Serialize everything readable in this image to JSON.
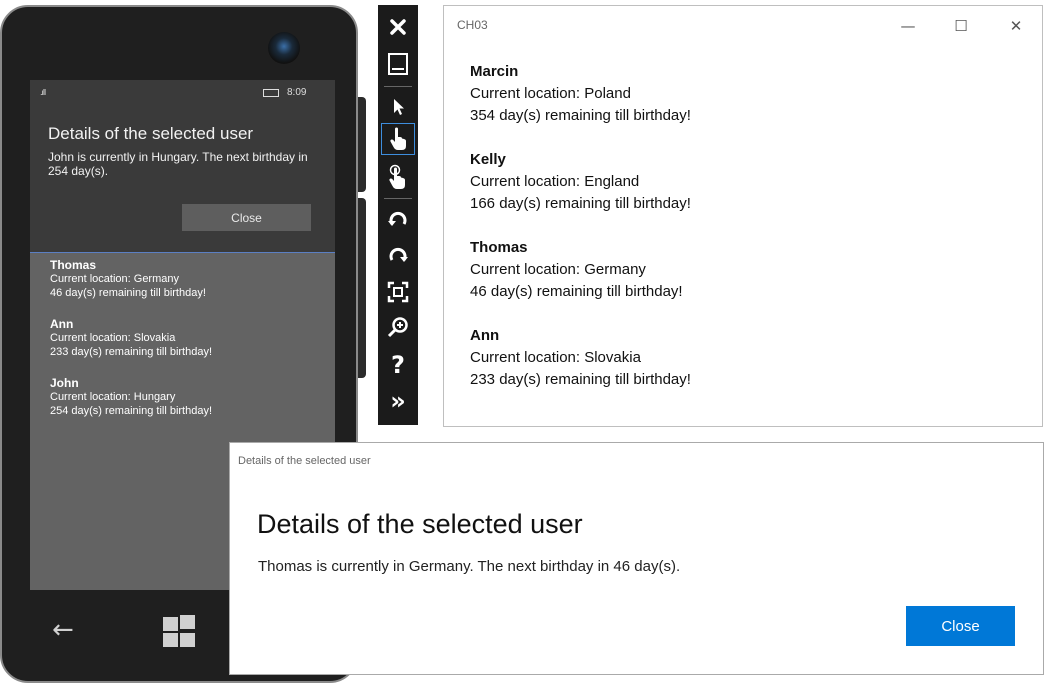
{
  "phone": {
    "status": {
      "time": "8:09",
      "signal": ".ıll"
    },
    "dialog": {
      "title": "Details of the selected user",
      "message": "John is currently in Hungary. The next birthday in 254 day(s).",
      "close_label": "Close"
    },
    "people": [
      {
        "name": "Thomas",
        "location": "Current location:  Germany",
        "birthday": "46 day(s) remaining till birthday!"
      },
      {
        "name": "Ann",
        "location": "Current location:  Slovakia",
        "birthday": "233 day(s) remaining till birthday!"
      },
      {
        "name": "John",
        "location": "Current location:  Hungary",
        "birthday": "254 day(s) remaining till birthday!"
      }
    ],
    "nav": {
      "back_icon": "←"
    }
  },
  "toolbar": {
    "items": [
      {
        "icon": "close-icon",
        "glyph": "✕"
      },
      {
        "icon": "minimize-icon",
        "glyph": "▁"
      },
      {
        "icon": "pointer-icon",
        "glyph": "➤"
      },
      {
        "icon": "single-touch-icon",
        "glyph": "☝"
      },
      {
        "icon": "pinch-zoom-icon",
        "glyph": "☝"
      },
      {
        "icon": "rotate-left-icon",
        "glyph": "↺"
      },
      {
        "icon": "rotate-right-icon",
        "glyph": "↻"
      },
      {
        "icon": "fit-screen-icon",
        "glyph": "⛶"
      },
      {
        "icon": "zoom-icon",
        "glyph": "⊕"
      },
      {
        "icon": "help-icon",
        "glyph": "?"
      },
      {
        "icon": "more-icon",
        "glyph": "»"
      }
    ]
  },
  "window": {
    "title": "CH03",
    "minimize": "—",
    "maximize": "☐",
    "close": "✕",
    "people": [
      {
        "name": "Marcin",
        "location": "Current location:  Poland",
        "birthday": "354 day(s) remaining till birthday!"
      },
      {
        "name": "Kelly",
        "location": "Current location:  England",
        "birthday": "166 day(s) remaining till birthday!"
      },
      {
        "name": "Thomas",
        "location": "Current location:  Germany",
        "birthday": "46 day(s) remaining till birthday!"
      },
      {
        "name": "Ann",
        "location": "Current location:  Slovakia",
        "birthday": "233 day(s) remaining till birthday!"
      }
    ]
  },
  "dialog": {
    "header": "Details of the selected user",
    "title": "Details of the selected user",
    "message": "Thomas is currently in Germany. The next birthday in 46 day(s).",
    "close_label": "Close",
    "accent": "#0078d7"
  }
}
